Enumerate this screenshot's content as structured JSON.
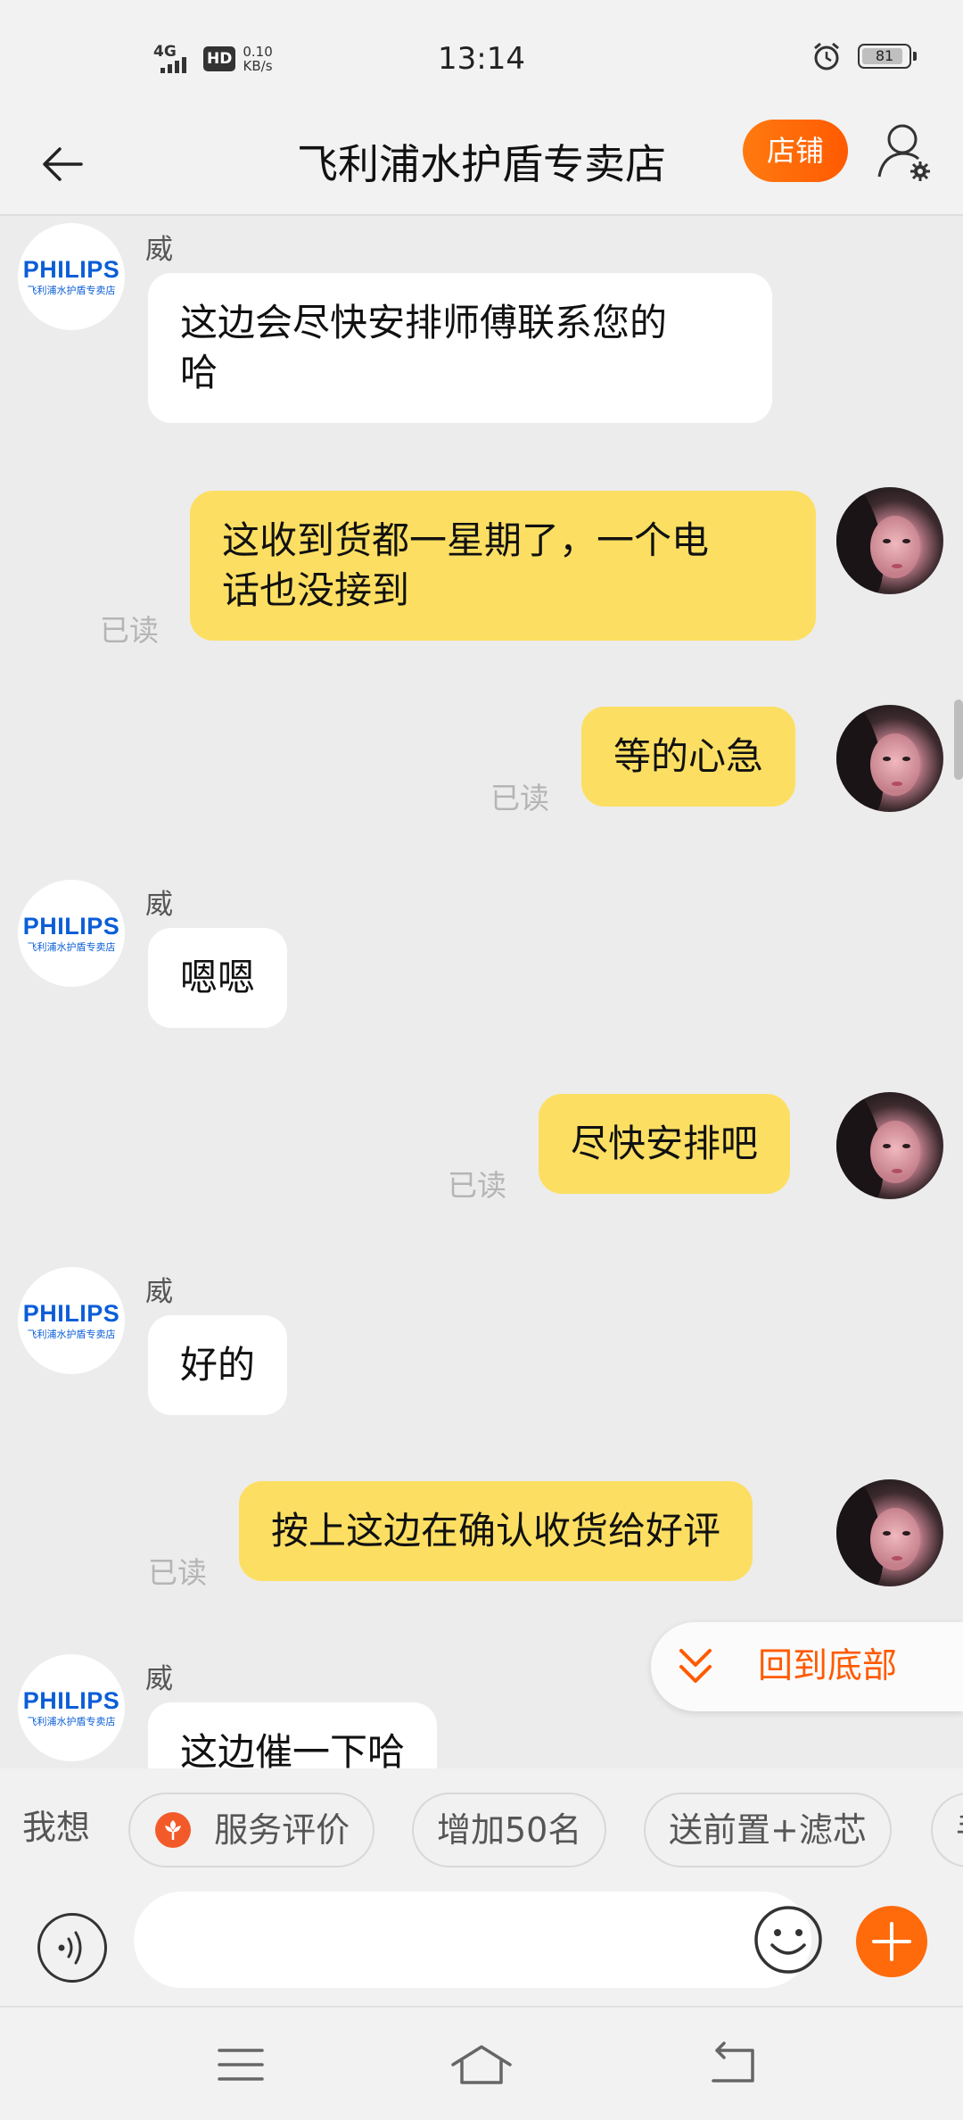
{
  "status_bar": {
    "network": "4G",
    "hd": "HD",
    "speed_value": "0.10",
    "speed_unit": "KB/s",
    "time": "13:14",
    "battery": "81",
    "battery_level": 0.81
  },
  "header": {
    "title": "飞利浦水护盾专卖店",
    "shop_button": "店铺",
    "icons": {
      "back": "back-arrow-icon",
      "user_settings": "user-settings-icon"
    }
  },
  "shop_avatar": {
    "brand": "PHILIPS",
    "sub": "飞利浦水护盾专卖店"
  },
  "messages": [
    {
      "side": "in",
      "sender": "威",
      "text_line1": "这边会尽快安排师傅联系您的",
      "text_line2": "哈"
    },
    {
      "side": "out",
      "text_line1": "这收到货都一星期了，一个电",
      "text_line2": "话也没接到",
      "status": "已读"
    },
    {
      "side": "out",
      "text": "等的心急",
      "status": "已读"
    },
    {
      "side": "in",
      "sender": "威",
      "text": "嗯嗯"
    },
    {
      "side": "out",
      "text": "尽快安排吧",
      "status": "已读"
    },
    {
      "side": "in",
      "sender": "威",
      "text": "好的"
    },
    {
      "side": "out",
      "text": "按上这边在确认收货给好评",
      "status": "已读"
    },
    {
      "side": "in",
      "sender": "威",
      "text": "这边催一下哈"
    }
  ],
  "scroll_to_bottom": {
    "label": "回到底部",
    "icon": "double-chevron-down-icon"
  },
  "suggestions": {
    "prefix": "我想",
    "chips": [
      "服务评价",
      "增加50名",
      "送前置+滤芯",
      "手"
    ]
  },
  "input": {
    "placeholder": ""
  },
  "colors": {
    "accent": "#ff6a0b",
    "bubble_out": "#fcdf62",
    "bubble_in": "#ffffff",
    "background": "#ececec"
  }
}
